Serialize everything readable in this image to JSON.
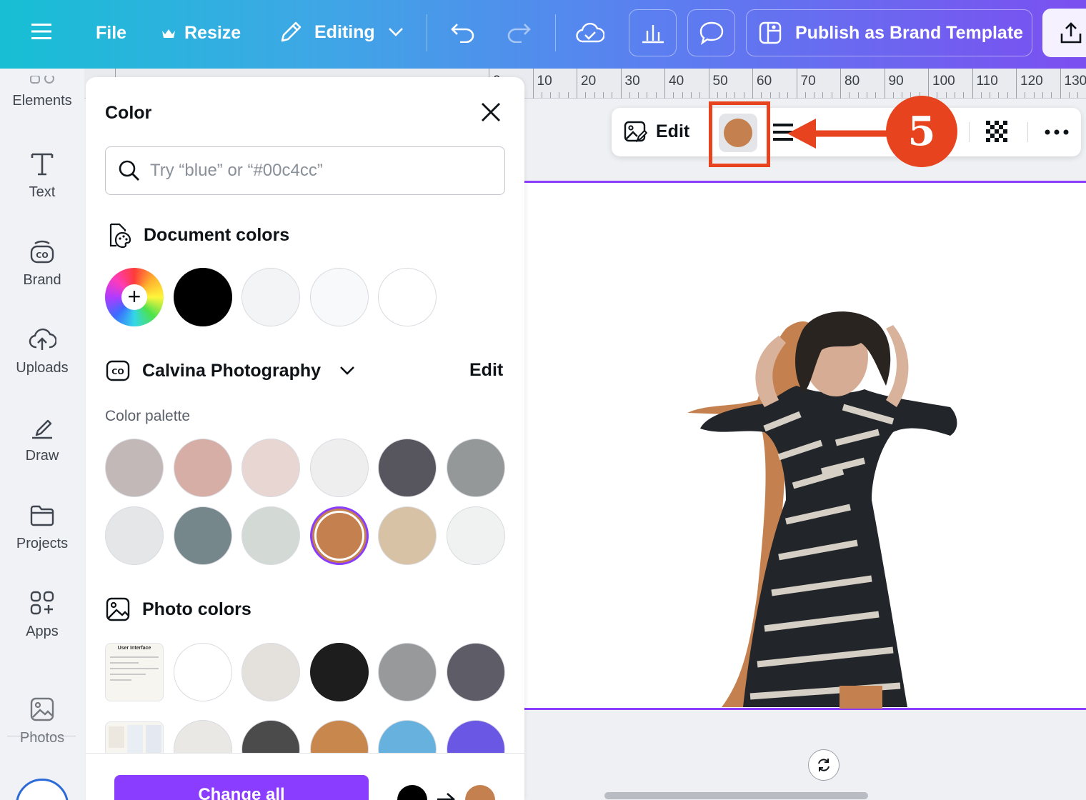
{
  "topbar": {
    "file": "File",
    "resize": "Resize",
    "editing": "Editing",
    "publish": "Publish as Brand Template"
  },
  "rail": {
    "items": [
      {
        "label": "Elements",
        "icon": "elements-icon"
      },
      {
        "label": "Text",
        "icon": "text-icon"
      },
      {
        "label": "Brand",
        "icon": "brand-icon"
      },
      {
        "label": "Uploads",
        "icon": "uploads-icon"
      },
      {
        "label": "Draw",
        "icon": "draw-icon"
      },
      {
        "label": "Projects",
        "icon": "projects-icon"
      },
      {
        "label": "Apps",
        "icon": "apps-icon"
      },
      {
        "label": "Photos",
        "icon": "photos-icon"
      }
    ]
  },
  "ruler": {
    "labels": [
      "0",
      "10",
      "20",
      "30",
      "40",
      "50",
      "60",
      "70",
      "80",
      "90",
      "100",
      "110",
      "120",
      "130"
    ]
  },
  "color_panel": {
    "title": "Color",
    "search_placeholder": "Try “blue” or “#00c4cc”",
    "document_colors": {
      "heading": "Document colors",
      "colors": [
        "#000000",
        "#f3f4f6",
        "#f8f9fb",
        "#ffffff"
      ]
    },
    "brand_kit": {
      "name": "Calvina Photography",
      "edit_label": "Edit",
      "palette_label": "Color palette",
      "colors": [
        "#c3b8b8",
        "#d6aea6",
        "#e8d6d3",
        "#efeeef",
        "#57565f",
        "#959899",
        "#e5e6e8",
        "#76878c",
        "#d3d9d5",
        "#c4804e",
        "#d8c2a6",
        "#f0f2f1"
      ],
      "selected_index": 9
    },
    "photo_colors": {
      "heading": "Photo colors",
      "row1": [
        "#ffffff",
        "#e4e1dc",
        "#1d1d1d",
        "#98999b",
        "#5e5c66"
      ],
      "row2": [
        "#e9e8e4",
        "#4b4b4b",
        "#c8884d",
        "#67b1df",
        "#6a57e4"
      ],
      "thumb1_caption": "User Interface"
    },
    "footer": {
      "change_all": "Change all",
      "from_color": "#000000",
      "to_color": "#c4804e"
    }
  },
  "floating_toolbar": {
    "edit_label": "Edit",
    "current_color": "#c4804e"
  },
  "annotation": {
    "step": "5",
    "accent": "#e8431f"
  }
}
